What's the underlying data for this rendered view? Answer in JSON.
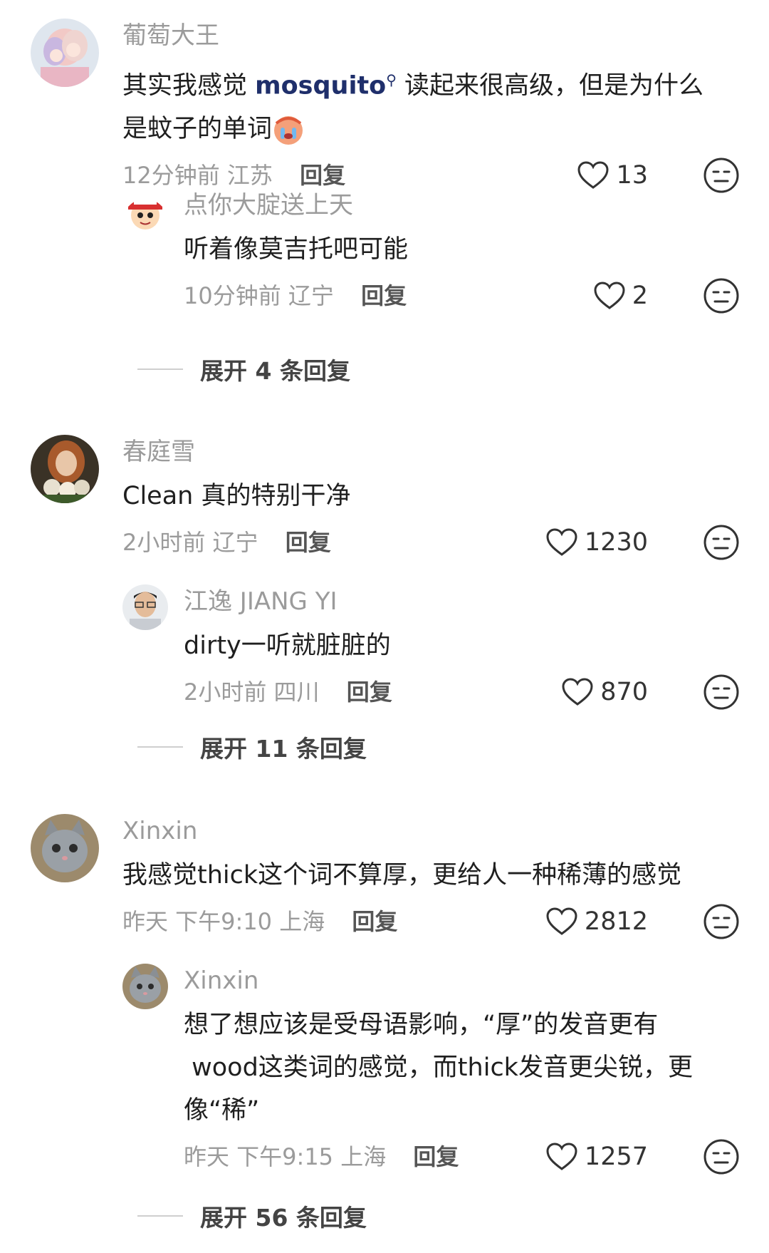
{
  "comments": [
    {
      "name": "葡萄大王",
      "text_before": "其实我感觉 ",
      "keyword": "mosquito",
      "text_after": " 读起来很高级，但是为什么",
      "text_line2": "是蚊子的单词",
      "time": "12分钟前",
      "location": "江苏",
      "reply_label": "回复",
      "likes": "13",
      "avatar_icon": "anime-couple-avatar",
      "replies": [
        {
          "name": "点你大腚送上天",
          "text": "听着像莫吉托吧可能",
          "time": "10分钟前",
          "location": "辽宁",
          "reply_label": "回复",
          "likes": "2",
          "avatar_icon": "cartoon-boy-cap-avatar"
        }
      ],
      "expand_label": "展开 4 条回复"
    },
    {
      "name": "春庭雪",
      "text": "Clean 真的特别干净",
      "time": "2小时前",
      "location": "辽宁",
      "reply_label": "回复",
      "likes": "1230",
      "avatar_icon": "woman-flowers-avatar",
      "replies": [
        {
          "name": "江逸 JIANG YI",
          "text": "dirty一听就脏脏的",
          "time": "2小时前",
          "location": "四川",
          "reply_label": "回复",
          "likes": "870",
          "avatar_icon": "man-glasses-avatar"
        }
      ],
      "expand_label": "展开 11 条回复"
    },
    {
      "name": "Xinxin",
      "text": "我感觉thick这个词不算厚，更给人一种稀薄的感觉",
      "time": "昨天 下午9:10",
      "location": "上海",
      "reply_label": "回复",
      "likes": "2812",
      "avatar_icon": "grey-kitten-avatar",
      "replies": [
        {
          "name": "Xinxin",
          "text": "想了想应该是受母语影响，“厚”的发音更有\n wood这类词的感觉，而thick发音更尖锐，更\n像“稀”",
          "time": "昨天 下午9:15",
          "location": "上海",
          "reply_label": "回复",
          "likes": "1257",
          "avatar_icon": "grey-kitten-avatar"
        }
      ],
      "expand_label": "展开 56 条回复"
    }
  ]
}
